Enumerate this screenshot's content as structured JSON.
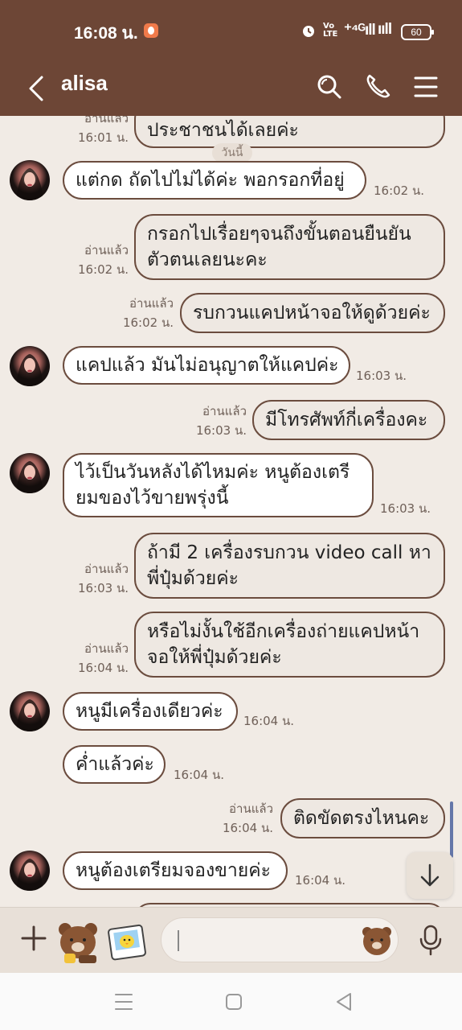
{
  "status_bar": {
    "time": "16:08 น.",
    "volte": "Vo LTE",
    "network": "⁺⁴ᴳıll",
    "signal": "ııll",
    "battery": "60"
  },
  "header": {
    "title": "alisa",
    "back_icon": "chevron-left-icon",
    "search_icon": "search-icon",
    "call_icon": "phone-icon",
    "menu_icon": "menu-icon"
  },
  "chat": {
    "date_chip": "วันนี้",
    "messages": [
      {
        "dir": "out",
        "lines": [
          "ประชาชนได้เลยค่ะ"
        ],
        "read": "อ่านแล้ว",
        "time": "16:01 น."
      },
      {
        "dir": "in",
        "lines": [
          "แต่กด ถัดไปไม่ได้ค่ะ พอกรอกที่อยู่"
        ],
        "time": "16:02 น."
      },
      {
        "dir": "out",
        "lines": [
          "กรอกไปเรื่อยๆจนถึงขั้นตอนยืนยัน",
          "ตัวตนเลยนะคะ"
        ],
        "read": "อ่านแล้ว",
        "time": "16:02 น."
      },
      {
        "dir": "out",
        "lines": [
          "รบกวนแคปหน้าจอให้ดูด้วยค่ะ"
        ],
        "read": "อ่านแล้ว",
        "time": "16:02 น."
      },
      {
        "dir": "in",
        "lines": [
          "แคปแล้ว มันไม่อนุญาตให้แคปค่ะ"
        ],
        "time": "16:03 น."
      },
      {
        "dir": "out",
        "lines": [
          "มีโทรศัพท์กี่เครื่องคะ"
        ],
        "read": "อ่านแล้ว",
        "time": "16:03 น."
      },
      {
        "dir": "in",
        "lines": [
          "ไว้เป็นวันหลังได้ไหมค่ะ หนูต้องเตรี",
          "ยมของไว้ขายพรุ่งนี้"
        ],
        "time": "16:03 น."
      },
      {
        "dir": "out",
        "lines": [
          "ถ้ามี 2 เครื่องรบกวน video call หา",
          "พี่ปุ๋มด้วยค่ะ"
        ],
        "read": "อ่านแล้ว",
        "time": "16:03 น."
      },
      {
        "dir": "out",
        "lines": [
          "หรือไม่งั้นใช้อีกเครื่องถ่ายแคปหน้า",
          "จอให้พี่ปุ๋มด้วยค่ะ"
        ],
        "read": "อ่านแล้ว",
        "time": "16:04 น."
      },
      {
        "dir": "in",
        "lines": [
          "หนูมีเครื่องเดียวค่ะ"
        ],
        "time": "16:04 น."
      },
      {
        "dir": "in",
        "lines": [
          "ค่ำแล้วค่ะ"
        ],
        "time": "16:04 น."
      },
      {
        "dir": "out",
        "lines": [
          "ติดขัดตรงไหนคะ"
        ],
        "read": "อ่านแล้ว",
        "time": "16:04 น."
      },
      {
        "dir": "in",
        "lines": [
          "หนูต้องเตรียมจองขายค่ะ"
        ],
        "time": "16:04 น."
      }
    ]
  },
  "input_bar": {
    "placeholder": "",
    "plus_icon": "plus-icon",
    "sticker_icon": "bear-sticker-icon",
    "photo_sticker_icon": "chick-sticker-icon",
    "emoji_icon": "bear-emoji-icon",
    "mic_icon": "microphone-icon"
  },
  "nav_bar": {
    "menu_icon": "recent-apps-icon",
    "home_icon": "home-icon",
    "back_icon": "back-triangle-icon"
  },
  "colors": {
    "header_bg": "#6d4636",
    "chat_bg": "#f1ebe5",
    "bubble_border": "#6b4c3e",
    "incoming_bubble": "#ffffff",
    "outgoing_bubble": "#eee8e2"
  }
}
